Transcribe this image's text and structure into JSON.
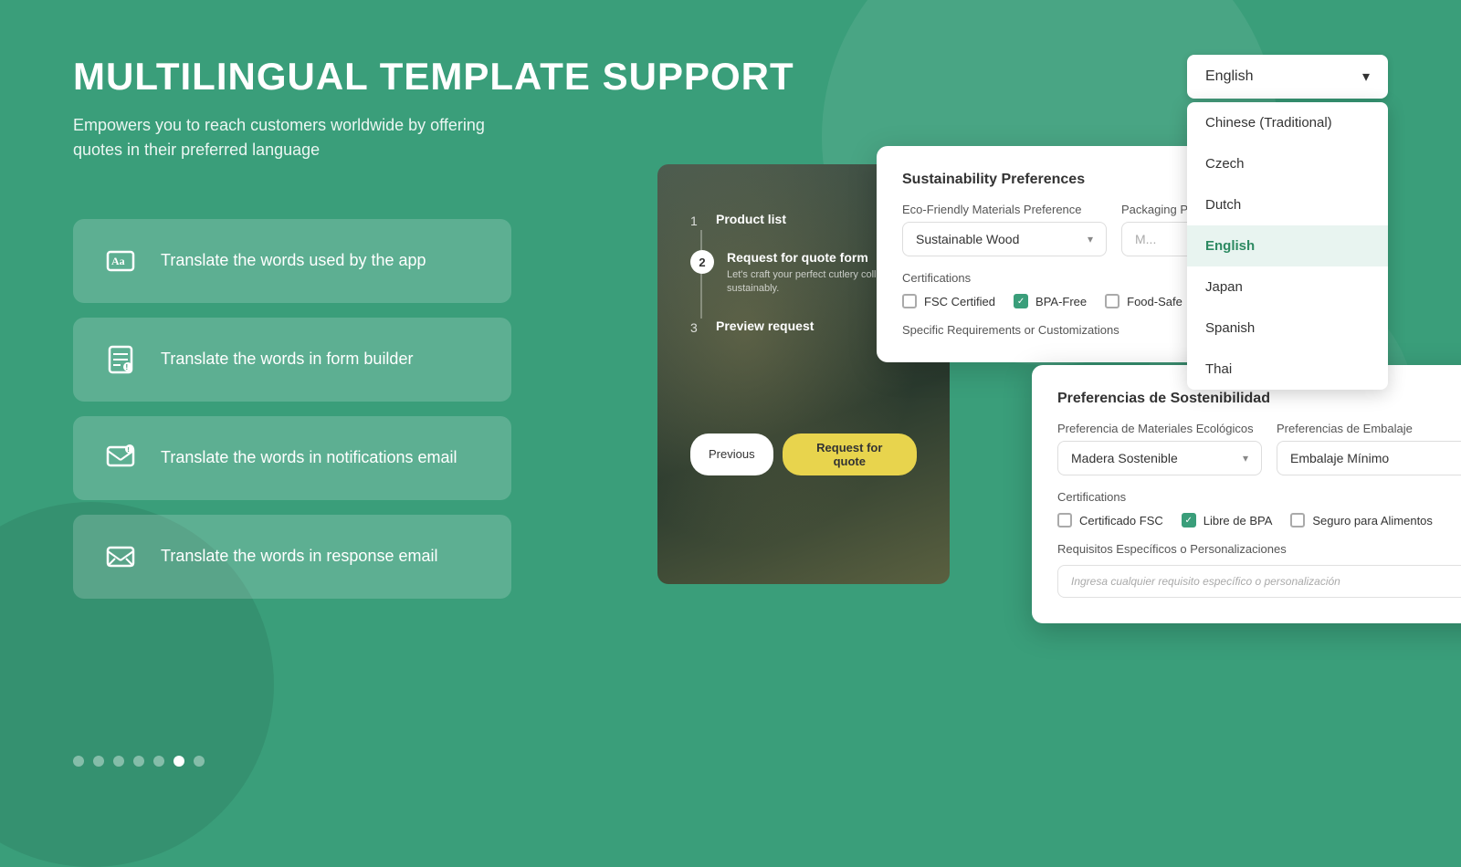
{
  "page": {
    "title": "MULTILINGUAL TEMPLATE SUPPORT",
    "subtitle": "Empowers you to reach customers worldwide by offering quotes in their preferred language"
  },
  "language_dropdown": {
    "current": "English",
    "chevron": "▾",
    "options": [
      {
        "label": "Chinese (Traditional)",
        "active": false
      },
      {
        "label": "Czech",
        "active": false
      },
      {
        "label": "Dutch",
        "active": false
      },
      {
        "label": "English",
        "active": true
      },
      {
        "label": "Japan",
        "active": false
      },
      {
        "label": "Spanish",
        "active": false
      },
      {
        "label": "Thai",
        "active": false
      }
    ]
  },
  "features": [
    {
      "icon": "Aa",
      "text": "Translate the words used by the app"
    },
    {
      "icon": "📄",
      "text": "Translate the words in form builder"
    },
    {
      "icon": "🔔",
      "text": "Translate the words in notifications email"
    },
    {
      "icon": "✉",
      "text": "Translate the words in response email"
    }
  ],
  "pagination": {
    "total": 7,
    "active_index": 5
  },
  "steps": [
    {
      "number": "1",
      "title": "Product list",
      "desc": ""
    },
    {
      "number": "2",
      "title": "Request for quote form",
      "desc": "Let's craft your perfect cutlery collection sustainably."
    },
    {
      "number": "3",
      "title": "Preview request",
      "desc": ""
    }
  ],
  "buttons": {
    "previous": "Previous",
    "request": "Request for quote"
  },
  "form_en": {
    "section_title": "Sustainability Preferences",
    "eco_label": "Eco-Friendly Materials Preference",
    "eco_value": "Sustainable Wood",
    "packaging_label": "Packaging Preferences",
    "certifications_label": "Certifications",
    "certifications": [
      {
        "label": "FSC Certified",
        "checked": false
      },
      {
        "label": "BPA-Free",
        "checked": true
      },
      {
        "label": "Food-Safe",
        "checked": false
      }
    ],
    "specific_req_label": "Specific Requirements or Customizations"
  },
  "form_es": {
    "section_title": "Preferencias de Sostenibilidad",
    "eco_label": "Preferencia de Materiales Ecológicos",
    "eco_value": "Madera Sostenible",
    "packaging_label": "Preferencias de Embalaje",
    "packaging_value": "Embalaje Mínimo",
    "certifications_label": "Certifications",
    "certifications": [
      {
        "label": "Certificado FSC",
        "checked": false
      },
      {
        "label": "Libre de BPA",
        "checked": true
      },
      {
        "label": "Seguro para Alimentos",
        "checked": false
      }
    ],
    "specific_req_label": "Requisitos Específicos o Personalizaciones",
    "specific_req_placeholder": "Ingresa cualquier requisito específico o personalización"
  }
}
